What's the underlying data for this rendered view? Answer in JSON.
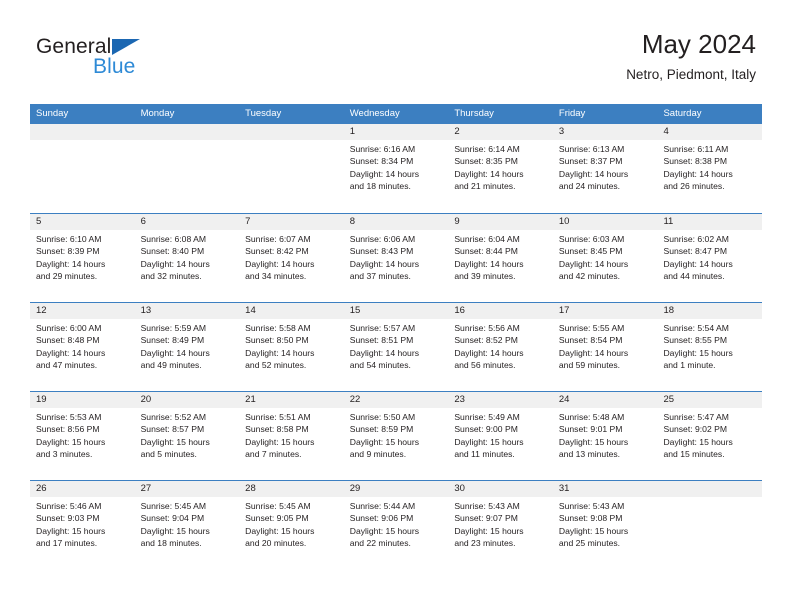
{
  "brand": {
    "name_part1": "General",
    "name_part2": "Blue",
    "logo_icon": "triangle-logo-icon",
    "accent_dark": "#1b67b2",
    "accent_light": "#2e8ad6"
  },
  "header": {
    "title": "May 2024",
    "subtitle": "Netro, Piedmont, Italy"
  },
  "theme": {
    "header_bar": "#3c7fc1",
    "day_number_bg": "#f0f0f0",
    "text": "#231f20",
    "page_bg": "#ffffff"
  },
  "calendar": {
    "weekdays": [
      "Sunday",
      "Monday",
      "Tuesday",
      "Wednesday",
      "Thursday",
      "Friday",
      "Saturday"
    ],
    "weeks": [
      [
        {
          "day": "",
          "lines": []
        },
        {
          "day": "",
          "lines": []
        },
        {
          "day": "",
          "lines": []
        },
        {
          "day": "1",
          "lines": [
            "Sunrise: 6:16 AM",
            "Sunset: 8:34 PM",
            "Daylight: 14 hours",
            "and 18 minutes."
          ]
        },
        {
          "day": "2",
          "lines": [
            "Sunrise: 6:14 AM",
            "Sunset: 8:35 PM",
            "Daylight: 14 hours",
            "and 21 minutes."
          ]
        },
        {
          "day": "3",
          "lines": [
            "Sunrise: 6:13 AM",
            "Sunset: 8:37 PM",
            "Daylight: 14 hours",
            "and 24 minutes."
          ]
        },
        {
          "day": "4",
          "lines": [
            "Sunrise: 6:11 AM",
            "Sunset: 8:38 PM",
            "Daylight: 14 hours",
            "and 26 minutes."
          ]
        }
      ],
      [
        {
          "day": "5",
          "lines": [
            "Sunrise: 6:10 AM",
            "Sunset: 8:39 PM",
            "Daylight: 14 hours",
            "and 29 minutes."
          ]
        },
        {
          "day": "6",
          "lines": [
            "Sunrise: 6:08 AM",
            "Sunset: 8:40 PM",
            "Daylight: 14 hours",
            "and 32 minutes."
          ]
        },
        {
          "day": "7",
          "lines": [
            "Sunrise: 6:07 AM",
            "Sunset: 8:42 PM",
            "Daylight: 14 hours",
            "and 34 minutes."
          ]
        },
        {
          "day": "8",
          "lines": [
            "Sunrise: 6:06 AM",
            "Sunset: 8:43 PM",
            "Daylight: 14 hours",
            "and 37 minutes."
          ]
        },
        {
          "day": "9",
          "lines": [
            "Sunrise: 6:04 AM",
            "Sunset: 8:44 PM",
            "Daylight: 14 hours",
            "and 39 minutes."
          ]
        },
        {
          "day": "10",
          "lines": [
            "Sunrise: 6:03 AM",
            "Sunset: 8:45 PM",
            "Daylight: 14 hours",
            "and 42 minutes."
          ]
        },
        {
          "day": "11",
          "lines": [
            "Sunrise: 6:02 AM",
            "Sunset: 8:47 PM",
            "Daylight: 14 hours",
            "and 44 minutes."
          ]
        }
      ],
      [
        {
          "day": "12",
          "lines": [
            "Sunrise: 6:00 AM",
            "Sunset: 8:48 PM",
            "Daylight: 14 hours",
            "and 47 minutes."
          ]
        },
        {
          "day": "13",
          "lines": [
            "Sunrise: 5:59 AM",
            "Sunset: 8:49 PM",
            "Daylight: 14 hours",
            "and 49 minutes."
          ]
        },
        {
          "day": "14",
          "lines": [
            "Sunrise: 5:58 AM",
            "Sunset: 8:50 PM",
            "Daylight: 14 hours",
            "and 52 minutes."
          ]
        },
        {
          "day": "15",
          "lines": [
            "Sunrise: 5:57 AM",
            "Sunset: 8:51 PM",
            "Daylight: 14 hours",
            "and 54 minutes."
          ]
        },
        {
          "day": "16",
          "lines": [
            "Sunrise: 5:56 AM",
            "Sunset: 8:52 PM",
            "Daylight: 14 hours",
            "and 56 minutes."
          ]
        },
        {
          "day": "17",
          "lines": [
            "Sunrise: 5:55 AM",
            "Sunset: 8:54 PM",
            "Daylight: 14 hours",
            "and 59 minutes."
          ]
        },
        {
          "day": "18",
          "lines": [
            "Sunrise: 5:54 AM",
            "Sunset: 8:55 PM",
            "Daylight: 15 hours",
            "and 1 minute."
          ]
        }
      ],
      [
        {
          "day": "19",
          "lines": [
            "Sunrise: 5:53 AM",
            "Sunset: 8:56 PM",
            "Daylight: 15 hours",
            "and 3 minutes."
          ]
        },
        {
          "day": "20",
          "lines": [
            "Sunrise: 5:52 AM",
            "Sunset: 8:57 PM",
            "Daylight: 15 hours",
            "and 5 minutes."
          ]
        },
        {
          "day": "21",
          "lines": [
            "Sunrise: 5:51 AM",
            "Sunset: 8:58 PM",
            "Daylight: 15 hours",
            "and 7 minutes."
          ]
        },
        {
          "day": "22",
          "lines": [
            "Sunrise: 5:50 AM",
            "Sunset: 8:59 PM",
            "Daylight: 15 hours",
            "and 9 minutes."
          ]
        },
        {
          "day": "23",
          "lines": [
            "Sunrise: 5:49 AM",
            "Sunset: 9:00 PM",
            "Daylight: 15 hours",
            "and 11 minutes."
          ]
        },
        {
          "day": "24",
          "lines": [
            "Sunrise: 5:48 AM",
            "Sunset: 9:01 PM",
            "Daylight: 15 hours",
            "and 13 minutes."
          ]
        },
        {
          "day": "25",
          "lines": [
            "Sunrise: 5:47 AM",
            "Sunset: 9:02 PM",
            "Daylight: 15 hours",
            "and 15 minutes."
          ]
        }
      ],
      [
        {
          "day": "26",
          "lines": [
            "Sunrise: 5:46 AM",
            "Sunset: 9:03 PM",
            "Daylight: 15 hours",
            "and 17 minutes."
          ]
        },
        {
          "day": "27",
          "lines": [
            "Sunrise: 5:45 AM",
            "Sunset: 9:04 PM",
            "Daylight: 15 hours",
            "and 18 minutes."
          ]
        },
        {
          "day": "28",
          "lines": [
            "Sunrise: 5:45 AM",
            "Sunset: 9:05 PM",
            "Daylight: 15 hours",
            "and 20 minutes."
          ]
        },
        {
          "day": "29",
          "lines": [
            "Sunrise: 5:44 AM",
            "Sunset: 9:06 PM",
            "Daylight: 15 hours",
            "and 22 minutes."
          ]
        },
        {
          "day": "30",
          "lines": [
            "Sunrise: 5:43 AM",
            "Sunset: 9:07 PM",
            "Daylight: 15 hours",
            "and 23 minutes."
          ]
        },
        {
          "day": "31",
          "lines": [
            "Sunrise: 5:43 AM",
            "Sunset: 9:08 PM",
            "Daylight: 15 hours",
            "and 25 minutes."
          ]
        },
        {
          "day": "",
          "lines": []
        }
      ]
    ]
  }
}
